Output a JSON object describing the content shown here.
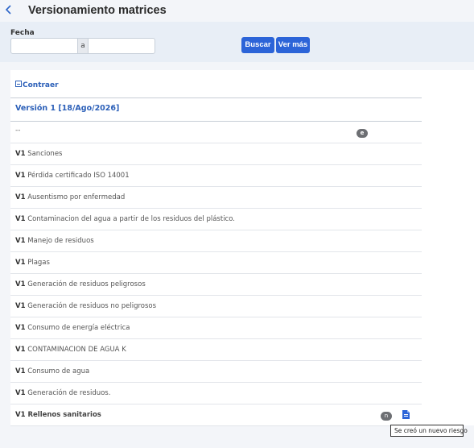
{
  "header": {
    "title": "Versionamiento matrices",
    "back_icon": "chevron-left-icon"
  },
  "filter": {
    "fecha_label": "Fecha",
    "date_from_value": "",
    "separator": "a",
    "date_to_value": "",
    "buscar_label": "Buscar",
    "ver_mas_label": "Ver más"
  },
  "panel": {
    "collapse_label": "Contraer",
    "version_title": "Versión 1 [18/Ago/2026]",
    "dash_row": "--",
    "e_badge": "e",
    "rows": [
      {
        "prefix": "V1",
        "text": "Sanciones"
      },
      {
        "prefix": "V1",
        "text": "Pérdida certificado ISO 14001"
      },
      {
        "prefix": "V1",
        "text": "Ausentismo por enfermedad"
      },
      {
        "prefix": "V1",
        "text": "Contaminacion del agua a partir de los residuos del plástico."
      },
      {
        "prefix": "V1",
        "text": "Manejo de residuos"
      },
      {
        "prefix": "V1",
        "text": "Plagas"
      },
      {
        "prefix": "V1",
        "text": "Generación de residuos peligrosos"
      },
      {
        "prefix": "V1",
        "text": "Generación de residuos no peligrosos"
      },
      {
        "prefix": "V1",
        "text": "Consumo de energía eléctrica"
      },
      {
        "prefix": "V1",
        "text": "CONTAMINACION DE AGUA K"
      },
      {
        "prefix": "V1",
        "text": "Consumo de agua"
      },
      {
        "prefix": "V1",
        "text": "Generación de residuos."
      },
      {
        "prefix": "V1",
        "text": "Rellenos sanitarios"
      }
    ],
    "last_row_badge": "n",
    "last_row_icon": "document-icon",
    "tooltip": "Se creó un nuevo riesgo"
  },
  "colors": {
    "accent": "#2c64d8",
    "link": "#2b5fb8",
    "background": "#f3f5f9",
    "filter_bar": "#e8eef6"
  }
}
